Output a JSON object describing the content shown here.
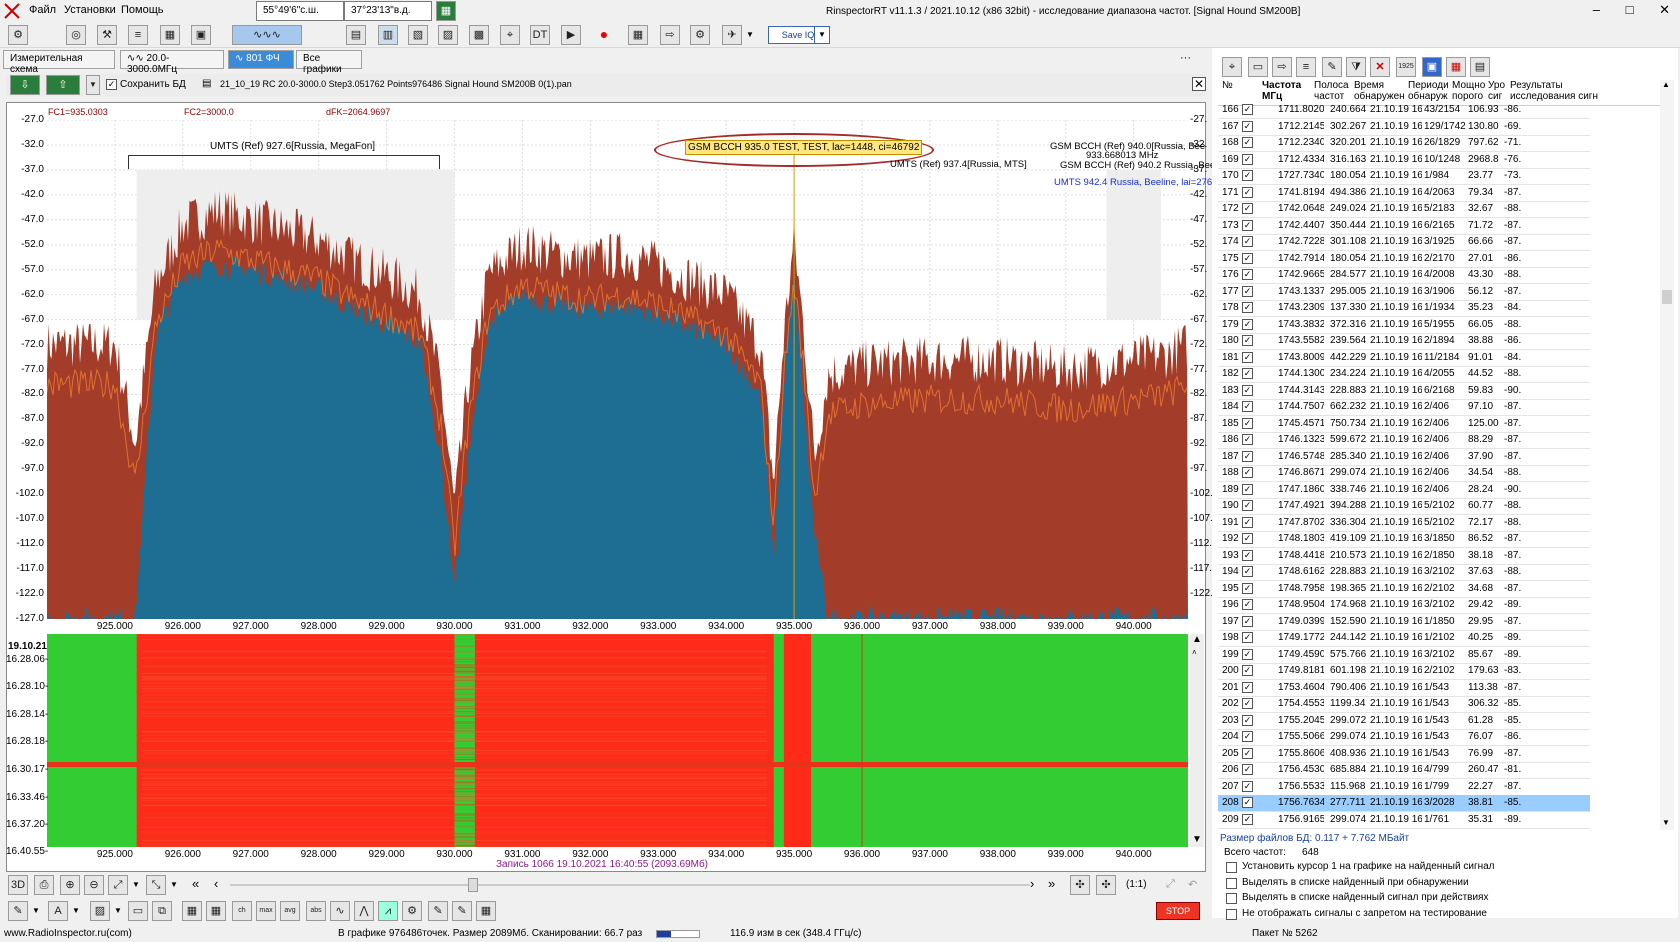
{
  "menu": {
    "items": [
      "Файл",
      "Установки",
      "Помощь"
    ],
    "lat": "55°49'6\"с.ш.",
    "lon": "37°23'13\"в.д.",
    "title": "RinspectorRT v11.1.3 / 2021.10.12 (x86 32bit) - исследование диапазона частот. [Signal Hound SM200B]"
  },
  "toolbar": {
    "saveiq_label": "Save IQ"
  },
  "tabs": [
    {
      "label": "Измерительная схема"
    },
    {
      "label": "20.0-3000.0МГц"
    },
    {
      "label": "801 ФЧ"
    },
    {
      "label": "Все графики"
    }
  ],
  "filebar": {
    "save_db": "Сохранить БД",
    "filename": "21_10_19 RC 20.0-3000.0 Step3.051762 Points976486 Signal Hound SM200B 0(1).pan"
  },
  "markers": {
    "fc1": "FC1=935.0303",
    "fc2": "FC2=3000.0",
    "dfk": "dFK=2064.9697"
  },
  "annotations": {
    "umts_left": "UMTS (Ref) 927.6[Russia, MegaFon]",
    "gsm_test": "GSM BCCH 935.0 TEST, TEST, lac=1448, ci=46792",
    "umts_mts": "UMTS (Ref) 937.4[Russia, MTS]",
    "gsm_right1": "GSM BCCH (Ref) 940.0[Russia, Bee",
    "gsm_right2": "GSM BCCH (Ref) 940.2 Russia, Bee",
    "freq_marker": "933.668013 MHz",
    "umts_right": "UMTS 942.4 Russia, Beeline, lai=276"
  },
  "chart_data": {
    "type": "area",
    "xlim": [
      924.0,
      940.8
    ],
    "ylim": [
      -127.0,
      -27.0
    ],
    "yticks": [
      "-27.0",
      "-32.0",
      "-37.0",
      "-42.0",
      "-47.0",
      "-52.0",
      "-57.0",
      "-62.0",
      "-67.0",
      "-72.0",
      "-77.0",
      "-82.0",
      "-87.0",
      "-92.0",
      "-97.0",
      "-102.0",
      "-107.0",
      "-112.0",
      "-117.0",
      "-122.0",
      "-127.0"
    ],
    "yticks_right": [
      "-27.",
      "-32.",
      "-37.",
      "-42.",
      "-47.",
      "-52.",
      "-57.",
      "-62.",
      "-67.",
      "-72.",
      "-77.",
      "-82.",
      "-87.",
      "-92.",
      "-97.",
      "-102.",
      "-107.",
      "-112.",
      "-117.",
      "-122."
    ],
    "xticks": [
      "925.000",
      "926.000",
      "927.000",
      "928.000",
      "929.000",
      "930.000",
      "931.000",
      "932.000",
      "933.000",
      "934.000",
      "935.000",
      "936.000",
      "937.000",
      "938.000",
      "939.000",
      "940.000"
    ],
    "series": [
      {
        "x": [
          924.0,
          925.0,
          925.3,
          925.6,
          926.0,
          926.5,
          927.0,
          927.5,
          928.0,
          928.5,
          929.0,
          929.5,
          929.8,
          930.0,
          930.2,
          930.5,
          931.0,
          931.5,
          932.0,
          932.5,
          933.0,
          933.5,
          934.0,
          934.5,
          934.7,
          934.85,
          935.0,
          935.15,
          935.3,
          935.5,
          936.0,
          937.0,
          938.0,
          939.0,
          939.5,
          940.0,
          940.5,
          940.8
        ],
        "values": [
          -72,
          -72,
          -92,
          -60,
          -48,
          -45,
          -47,
          -49,
          -51,
          -55,
          -58,
          -62,
          -80,
          -105,
          -80,
          -58,
          -52,
          -54,
          -55,
          -54,
          -56,
          -59,
          -62,
          -72,
          -100,
          -70,
          -51,
          -70,
          -95,
          -78,
          -76,
          -75,
          -75,
          -77,
          -76,
          -75,
          -74,
          -72
        ]
      },
      {
        "x": [
          924.0,
          925.0,
          925.3,
          925.6,
          926.0,
          926.5,
          927.0,
          927.5,
          928.0,
          928.5,
          929.0,
          929.5,
          929.8,
          930.0,
          930.2,
          930.5,
          931.0,
          931.5,
          932.0,
          932.5,
          933.0,
          933.5,
          934.0,
          934.5,
          934.7,
          934.85,
          935.0,
          935.15,
          935.3,
          935.5,
          936.0,
          937.0,
          938.0,
          939.0,
          939.5,
          940.0,
          940.5,
          940.8
        ],
        "values": [
          -127,
          -127,
          -127,
          -70,
          -58,
          -56,
          -57,
          -59,
          -61,
          -65,
          -68,
          -72,
          -95,
          -120,
          -95,
          -68,
          -62,
          -64,
          -65,
          -64,
          -66,
          -69,
          -72,
          -82,
          -115,
          -80,
          -58,
          -85,
          -110,
          -127,
          -127,
          -127,
          -127,
          -127,
          -127,
          -127,
          -127,
          -127
        ]
      }
    ]
  },
  "waterfall": {
    "date": "19.10.21",
    "times": [
      "16.28.06-",
      "16.28.10-",
      "16.28.14-",
      "16.28.18-",
      "16.30.17-",
      "16.33.46-",
      "16.37.20-",
      "16.40.55-"
    ],
    "record": "Запись 1066 19.10.2021 16:40:55 (2093.69Мб)"
  },
  "bottom": {
    "ratio": "(1:1)",
    "stop": "STOP"
  },
  "table": {
    "headers": [
      "№",
      "Частота МГц",
      "Полоса частот",
      "Время обнаружен",
      "Периоди обнаруж",
      "Мощно порого",
      "Уро сиг",
      "Результаты исследования сигн"
    ],
    "rows": [
      [
        "166",
        "1711.8020",
        "240.664",
        "21.10.19 16",
        "43/2154",
        "106.93",
        "-86."
      ],
      [
        "167",
        "1712.2145",
        "302.267",
        "21.10.19 16",
        "129/1742",
        "130.80",
        "-69."
      ],
      [
        "168",
        "1712.2340",
        "320.201",
        "21.10.19 16",
        "26/1829",
        "797.62",
        "-71."
      ],
      [
        "169",
        "1712.4334",
        "316.163",
        "21.10.19 16",
        "10/1248",
        "2968.8",
        "-76."
      ],
      [
        "170",
        "1727.7340",
        "180.054",
        "21.10.19 16",
        "1/984",
        "23.77",
        "-73."
      ],
      [
        "171",
        "1741.8194",
        "494.386",
        "21.10.19 16",
        "4/2063",
        "79.34",
        "-87."
      ],
      [
        "172",
        "1742.0648",
        "249.024",
        "21.10.19 16",
        "5/2183",
        "32.67",
        "-88."
      ],
      [
        "173",
        "1742.4407",
        "350.444",
        "21.10.19 16",
        "6/2165",
        "71.72",
        "-87."
      ],
      [
        "174",
        "1742.7228",
        "301.108",
        "21.10.19 16",
        "3/1925",
        "66.66",
        "-87."
      ],
      [
        "175",
        "1742.7914",
        "180.054",
        "21.10.19 16",
        "2/2170",
        "27.01",
        "-86."
      ],
      [
        "176",
        "1742.9665",
        "284.577",
        "21.10.19 16",
        "4/2008",
        "43.30",
        "-88."
      ],
      [
        "177",
        "1743.1337",
        "295.005",
        "21.10.19 16",
        "3/1906",
        "56.12",
        "-87."
      ],
      [
        "178",
        "1743.2309",
        "137.330",
        "21.10.19 16",
        "1/1934",
        "35.23",
        "-84."
      ],
      [
        "179",
        "1743.3832",
        "372.316",
        "21.10.19 16",
        "5/1955",
        "66.05",
        "-88."
      ],
      [
        "180",
        "1743.5582",
        "239.564",
        "21.10.19 16",
        "2/1894",
        "38.88",
        "-86."
      ],
      [
        "181",
        "1743.8009",
        "442.229",
        "21.10.19 16",
        "11/2184",
        "91.01",
        "-84."
      ],
      [
        "182",
        "1744.1300",
        "234.224",
        "21.10.19 16",
        "4/2055",
        "44.52",
        "-88."
      ],
      [
        "183",
        "1744.3143",
        "228.883",
        "21.10.19 16",
        "6/2168",
        "59.83",
        "-90."
      ],
      [
        "184",
        "1744.7507",
        "662.232",
        "21.10.19 16",
        "2/406",
        "97.10",
        "-87."
      ],
      [
        "185",
        "1745.4571",
        "750.734",
        "21.10.19 16",
        "2/406",
        "125.00",
        "-87."
      ],
      [
        "186",
        "1746.1323",
        "599.672",
        "21.10.19 16",
        "2/406",
        "88.29",
        "-87."
      ],
      [
        "187",
        "1746.5748",
        "285.340",
        "21.10.19 16",
        "2/406",
        "37.90",
        "-87."
      ],
      [
        "188",
        "1746.8671",
        "299.074",
        "21.10.19 16",
        "2/406",
        "34.54",
        "-88."
      ],
      [
        "189",
        "1747.1860",
        "338.746",
        "21.10.19 16",
        "2/406",
        "28.24",
        "-90."
      ],
      [
        "190",
        "1747.4921",
        "394.288",
        "21.10.19 16",
        "5/2102",
        "60.77",
        "-88."
      ],
      [
        "191",
        "1747.8702",
        "336.304",
        "21.10.19 16",
        "5/2102",
        "72.17",
        "-88."
      ],
      [
        "192",
        "1748.1803",
        "419.109",
        "21.10.19 16",
        "3/1850",
        "86.52",
        "-87."
      ],
      [
        "193",
        "1748.4418",
        "210.573",
        "21.10.19 16",
        "2/1850",
        "38.18",
        "-87."
      ],
      [
        "194",
        "1748.6162",
        "228.883",
        "21.10.19 16",
        "3/2102",
        "37.63",
        "-88."
      ],
      [
        "195",
        "1748.7958",
        "198.365",
        "21.10.19 16",
        "2/2102",
        "34.68",
        "-87."
      ],
      [
        "196",
        "1748.9504",
        "174.968",
        "21.10.19 16",
        "3/2102",
        "29.42",
        "-89."
      ],
      [
        "197",
        "1749.0399",
        "152.590",
        "21.10.19 16",
        "1/1850",
        "29.95",
        "-87."
      ],
      [
        "198",
        "1749.1772",
        "244.142",
        "21.10.19 16",
        "1/2102",
        "40.25",
        "-89."
      ],
      [
        "199",
        "1749.4590",
        "575.766",
        "21.10.19 16",
        "3/2102",
        "85.67",
        "-89."
      ],
      [
        "200",
        "1749.8181",
        "601.198",
        "21.10.19 16",
        "2/2102",
        "179.63",
        "-83."
      ],
      [
        "201",
        "1753.4604",
        "790.406",
        "21.10.19 16",
        "1/543",
        "113.38",
        "-87."
      ],
      [
        "202",
        "1754.4553",
        "1199.34",
        "21.10.19 16",
        "1/543",
        "306.32",
        "-85."
      ],
      [
        "203",
        "1755.2045",
        "299.072",
        "21.10.19 16",
        "1/543",
        "61.28",
        "-85."
      ],
      [
        "204",
        "1755.5066",
        "299.074",
        "21.10.19 16",
        "1/543",
        "76.07",
        "-86."
      ],
      [
        "205",
        "1755.8606",
        "408.936",
        "21.10.19 16",
        "1/543",
        "76.99",
        "-87."
      ],
      [
        "206",
        "1756.4530",
        "685.884",
        "21.10.19 16",
        "4/799",
        "260.47",
        "-81."
      ],
      [
        "207",
        "1756.5533",
        "115.968",
        "21.10.19 16",
        "1/799",
        "22.27",
        "-87."
      ],
      [
        "208",
        "1756.7634",
        "277.711",
        "21.10.19 16",
        "3/2028",
        "38.81",
        "-85."
      ],
      [
        "209",
        "1756.9165",
        "299.074",
        "21.10.19 16",
        "1/761",
        "35.31",
        "-89."
      ]
    ],
    "selected": 42
  },
  "dbinfo": {
    "size": "Размер файлов БД: 0.117 + 7.762 МБайт",
    "total_label": "Всего частот:",
    "total": "648",
    "options": [
      "Установить курсор 1 на графике на найденный сигнал",
      "Выделять в списке найденный при обнаружении",
      "Выделять в списке найденный сигнал при действиях",
      "Не отображать сигналы с запретом на тестирование"
    ]
  },
  "statusbar": {
    "site": "www.RadioInspector.ru(com)",
    "points": "В графике 976486точек.  Размер 2089Мб. Сканировании: 66.7 раз",
    "rate": "116.9 изм в сек (348.4 ГГц/с)",
    "packet": "Пакет № 5262"
  },
  "colors": {
    "peak": "#a33d2a",
    "avg": "#1e6e93",
    "wf_green": "#33cc33",
    "wf_red": "#ff2a1a",
    "accent": "#3b8bd9"
  }
}
